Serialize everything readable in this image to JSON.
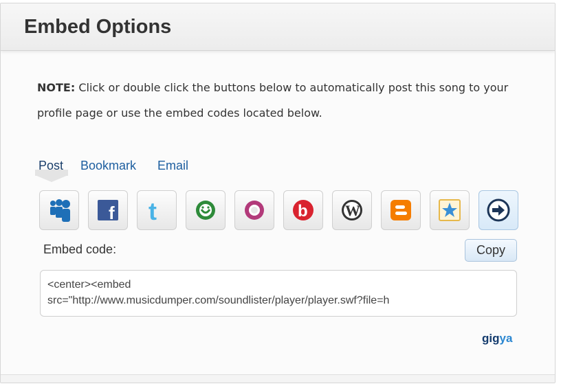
{
  "header": {
    "title": "Embed Options"
  },
  "note": {
    "label": "NOTE:",
    "text": " Click or double click the buttons below to automatically post this song to your profile page or use the embed codes located below."
  },
  "tabs": [
    {
      "label": "Post",
      "active": true
    },
    {
      "label": "Bookmark",
      "active": false
    },
    {
      "label": "Email",
      "active": false
    }
  ],
  "share_icons": [
    "myspace-icon",
    "facebook-icon",
    "twitter-icon",
    "orkut-icon",
    "orb-icon",
    "bebo-icon",
    "wordpress-icon",
    "blogger-icon",
    "favorite-star-icon",
    "more-arrow-icon"
  ],
  "embed": {
    "label": "Embed code:",
    "copy_label": "Copy",
    "code": "<center><embed\nsrc=\"http://www.musicdumper.com/soundlister/player/player.swf?file=h"
  },
  "brand": {
    "part1": "gig",
    "part2": "ya"
  },
  "colors": {
    "link": "#1e5fa0",
    "gigya_dark": "#153c6e",
    "gigya_light": "#2b87d1",
    "facebook": "#3b5998",
    "twitter": "#4ab3e6",
    "orkut": "#2e8b3a",
    "bebo": "#d9232f",
    "blogger": "#f57d00"
  }
}
